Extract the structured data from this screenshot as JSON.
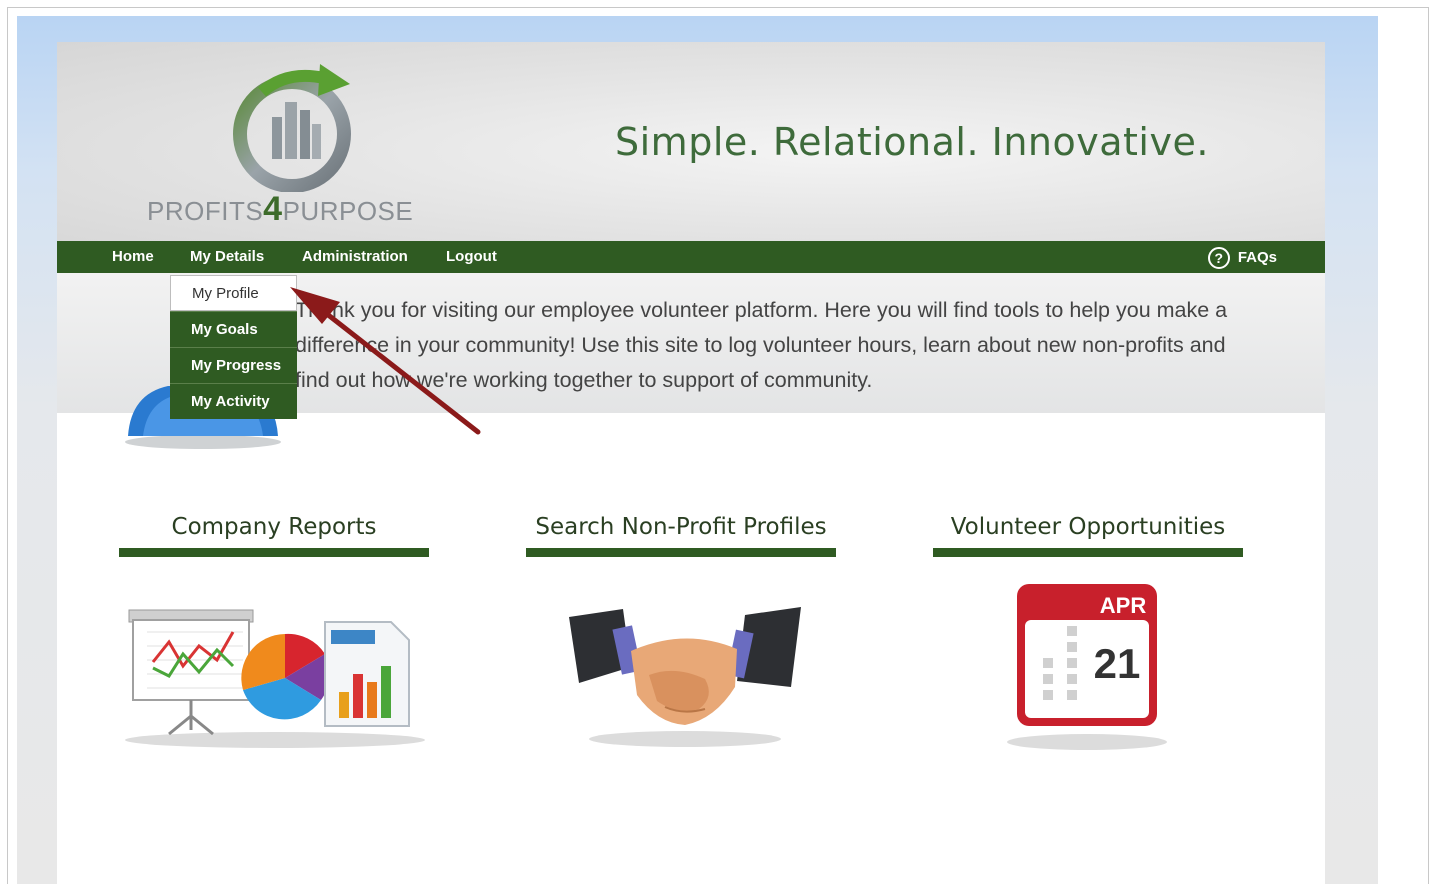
{
  "logo": {
    "text_left": "PROFITS",
    "text_four": "4",
    "text_right": "PURPOSE"
  },
  "tagline": "Simple. Relational. Innovative.",
  "nav": {
    "items": [
      "Home",
      "My Details",
      "Administration",
      "Logout"
    ],
    "faq_label": "FAQs",
    "faq_icon_glyph": "?"
  },
  "dropdown": {
    "items": [
      "My Profile",
      "My Goals",
      "My Progress",
      "My Activity"
    ],
    "active": "My Profile"
  },
  "welcome": "Thank you for visiting our employee volunteer platform. Here you will find tools to help you make a difference in your community! Use this site to log volunteer hours, learn about new non-profits and find out how we're working together to support of community.",
  "sections": [
    {
      "title": "Company Reports",
      "icon": "presentation-charts-icon"
    },
    {
      "title": "Search Non-Profit Profiles",
      "icon": "handshake-icon"
    },
    {
      "title": "Volunteer Opportunities",
      "icon": "calendar-icon"
    }
  ],
  "calendar": {
    "month": "APR",
    "day": "21"
  },
  "colors": {
    "nav_green": "#2f5b22",
    "tagline_green": "#3e6b3b",
    "calendar_red": "#c8202c"
  }
}
